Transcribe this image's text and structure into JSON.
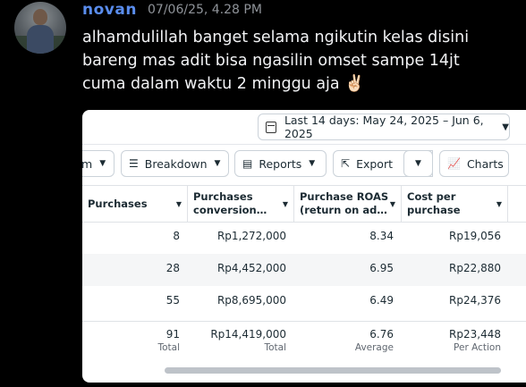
{
  "chat": {
    "username": "novan",
    "timestamp": "07/06/25, 4.28 PM",
    "message_lines": [
      "alhamdulillah banget selama ngikutin kelas disini",
      "bareng mas adit bisa ngasilin omset sampe 14jt",
      "cuma dalam waktu 2 minggu aja"
    ],
    "emoji": "✌🏻"
  },
  "report": {
    "date_range": "Last 14 days: May 24, 2025 – Jun 6, 2025",
    "toolbar": {
      "partial_label": "m",
      "breakdown": "Breakdown",
      "reports": "Reports",
      "export": "Export",
      "charts": "Charts"
    },
    "columns": [
      {
        "line1": "Purchases",
        "line2": ""
      },
      {
        "line1": "Purchases",
        "line2": "conversion…"
      },
      {
        "line1": "Purchase ROAS",
        "line2": "(return on ad…"
      },
      {
        "line1": "Cost per",
        "line2": "purchase"
      }
    ],
    "rows": [
      {
        "purchases": "8",
        "conversion": "Rp1,272,000",
        "roas": "8.34",
        "cpp": "Rp19,056"
      },
      {
        "purchases": "28",
        "conversion": "Rp4,452,000",
        "roas": "6.95",
        "cpp": "Rp22,880"
      },
      {
        "purchases": "55",
        "conversion": "Rp8,695,000",
        "roas": "6.49",
        "cpp": "Rp24,376"
      }
    ],
    "totals": {
      "purchases": "91",
      "purchases_label": "Total",
      "conversion": "Rp14,419,000",
      "conversion_label": "Total",
      "roas": "6.76",
      "roas_label": "Average",
      "cpp": "Rp23,448",
      "cpp_label": "Per Action"
    }
  }
}
